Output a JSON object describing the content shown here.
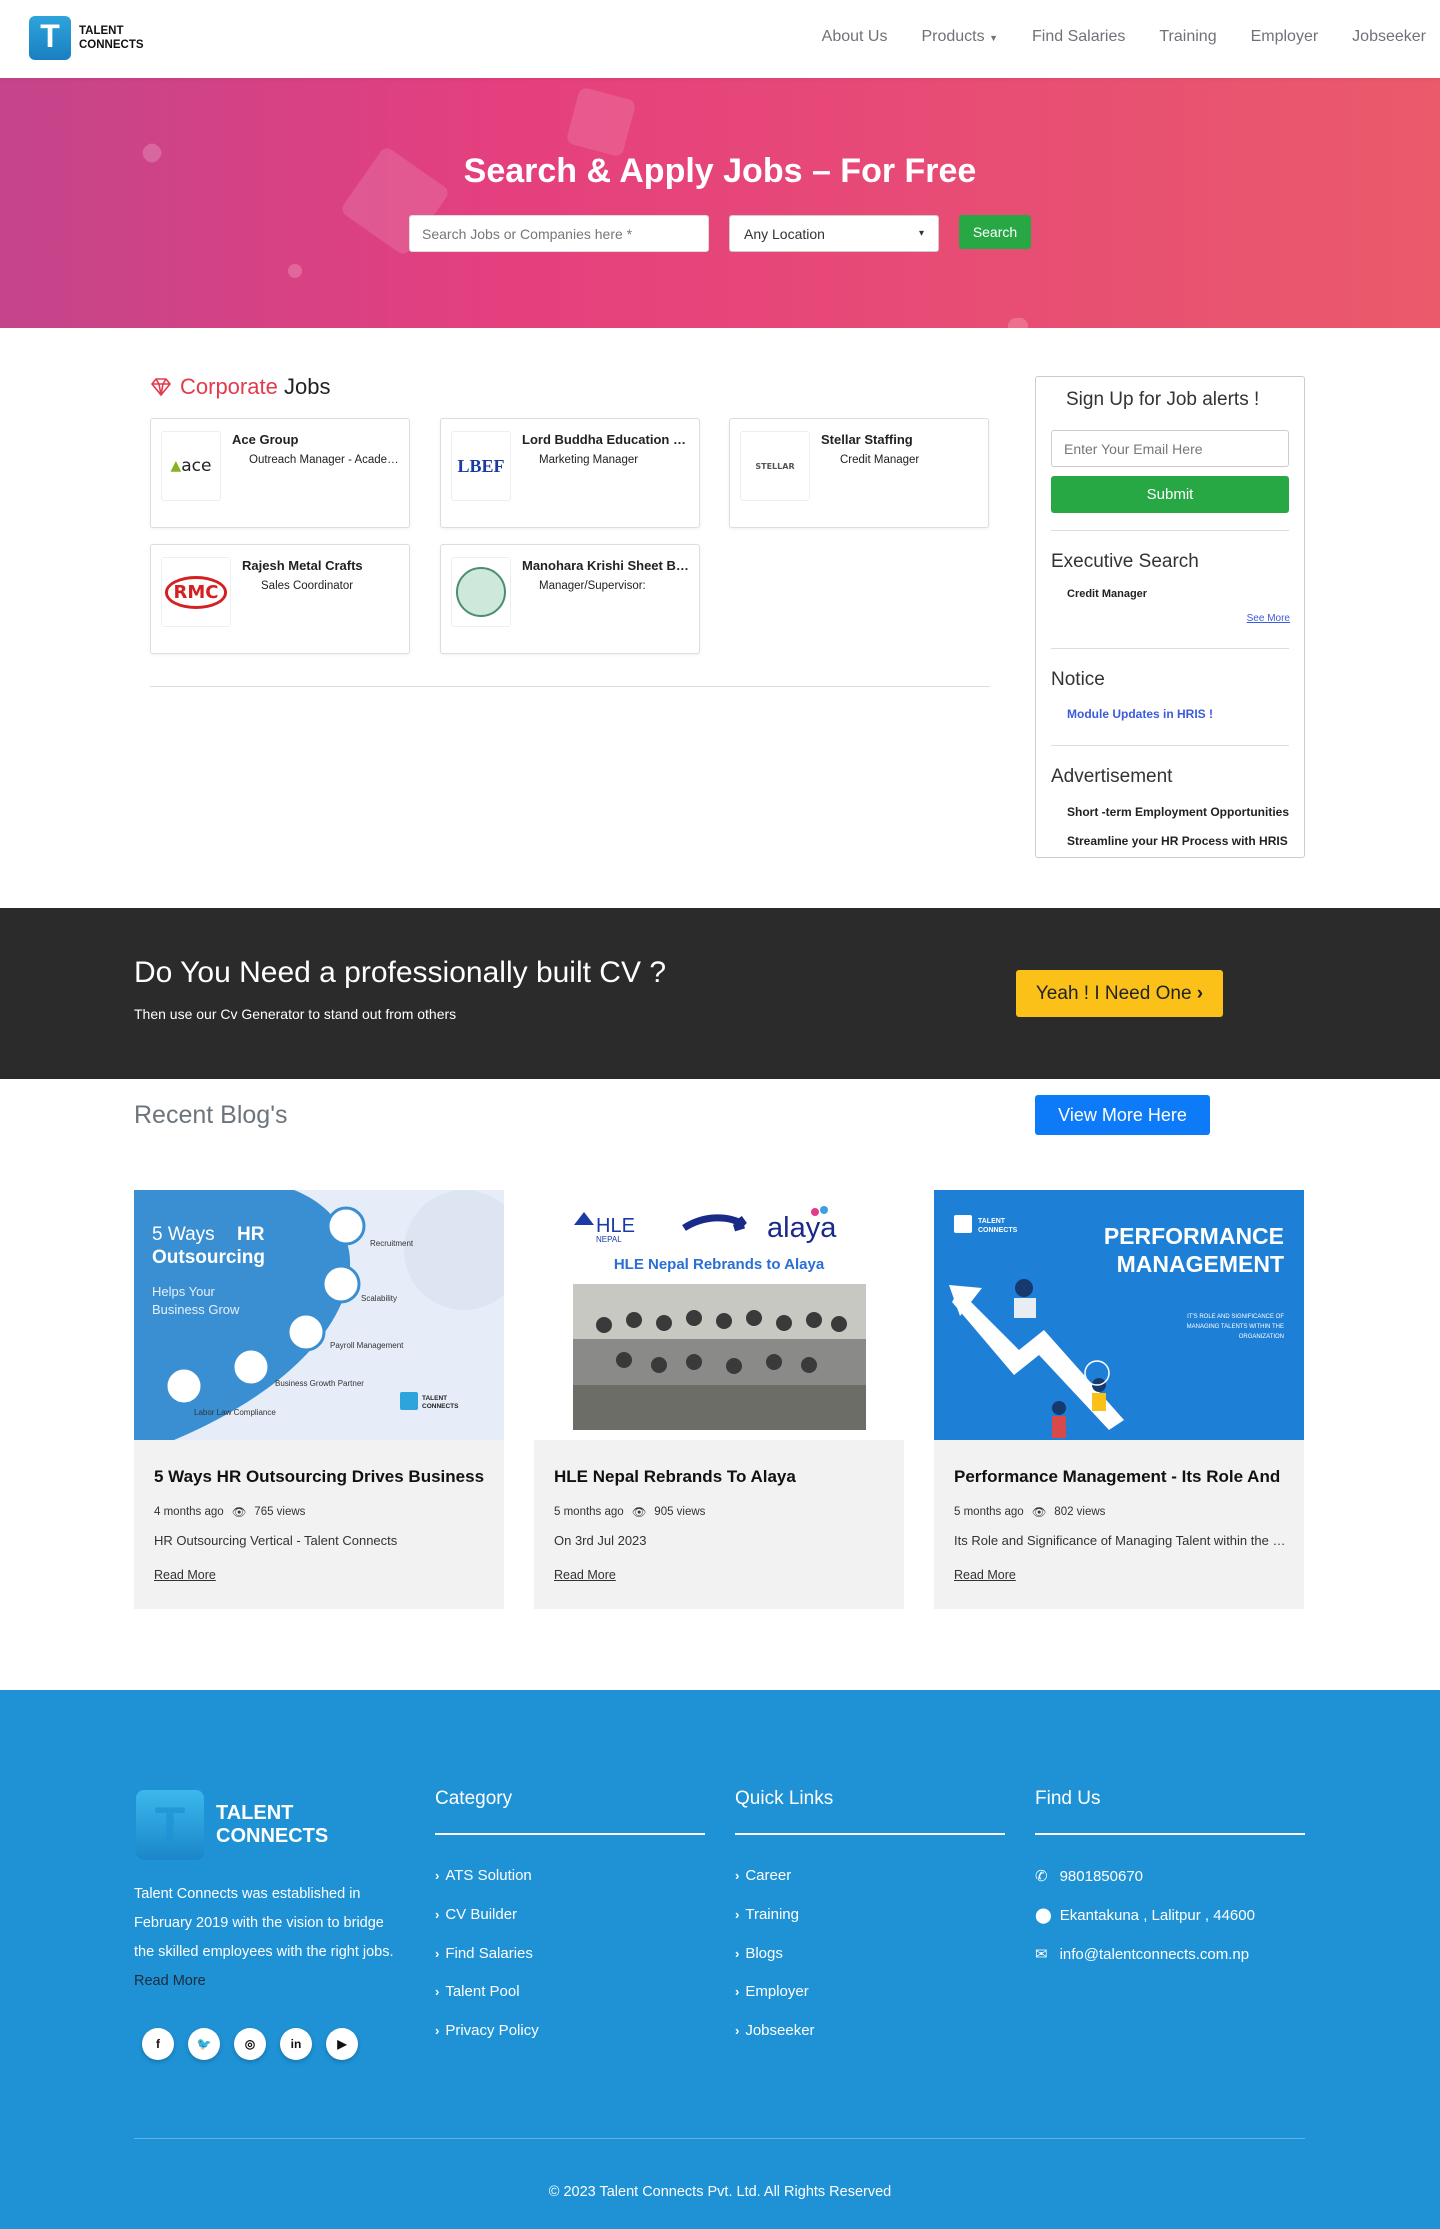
{
  "header": {
    "logo_text_line1": "TALENT",
    "logo_text_line2": "CONNECTS",
    "nav": [
      "About Us",
      "Products",
      "Find Salaries",
      "Training",
      "Employer",
      "Jobseeker"
    ]
  },
  "hero": {
    "title": "Search & Apply Jobs – For Free",
    "search_placeholder": "Search Jobs or Companies here *",
    "location_value": "Any Location",
    "search_label": "Search"
  },
  "corporate": {
    "title_accent": "Corporate",
    "title_rest": "Jobs",
    "cards": [
      {
        "company": "Ace Group",
        "position": "Outreach Manager - Academic...",
        "logo_text": "ace"
      },
      {
        "company": "Lord Buddha Education Foundation",
        "position": "Marketing Manager",
        "logo_text": "LBEF"
      },
      {
        "company": "Stellar Staffing",
        "position": "Credit Manager",
        "logo_text": "STELLAR"
      },
      {
        "company": "Rajesh Metal Crafts",
        "position": "Sales Coordinator",
        "logo_text": "RMC"
      },
      {
        "company": "Manohara Krishi Sheet Bhandar",
        "position": "Manager/Supervisor:",
        "logo_text": ""
      }
    ]
  },
  "sidebar": {
    "signup_title": "Sign Up for Job alerts !",
    "email_placeholder": "Enter Your Email Here",
    "submit_label": "Submit",
    "exec_title": "Executive Search",
    "exec_items": [
      "Credit Manager"
    ],
    "see_more": "See More",
    "notice_title": "Notice",
    "notice_items": [
      "Module Updates in HRIS !"
    ],
    "ad_title": "Advertisement",
    "ad_items": [
      "Short -term Employment Opportunities",
      "Streamline your HR Process with HRIS"
    ]
  },
  "cv": {
    "title": "Do You Need a professionally built CV ?",
    "subtitle": "Then use our Cv Generator to stand out from others",
    "button": "Yeah ! I Need One"
  },
  "blogs": {
    "title": "Recent Blog's",
    "view_more": "View More Here",
    "items": [
      {
        "title": "5 Ways HR Outsourcing Drives Business",
        "time": "4 months ago",
        "views": "765 views",
        "desc": "HR Outsourcing Vertical - Talent Connects",
        "read": "Read More"
      },
      {
        "title": "HLE Nepal Rebrands To Alaya",
        "time": "5 months ago",
        "views": "905 views",
        "desc": "On 3rd Jul 2023",
        "read": "Read More"
      },
      {
        "title": "Performance Management - Its Role And",
        "time": "5 months ago",
        "views": "802 views",
        "desc": "Its Role and Significance of Managing Talent within the Organization",
        "read": "Read More"
      }
    ],
    "img1": {
      "line1": "5 Ways",
      "line1b": "HR",
      "line2": "Outsourcing",
      "sub1": "Helps Your",
      "sub2": "Business Grow",
      "labels": [
        "Recruitment",
        "Scalability",
        "Payroll Management",
        "Business Growth Partner",
        "Labor Law Compliance"
      ],
      "brand1": "TALENT",
      "brand2": "CONNECTS"
    },
    "img2": {
      "hle": "HLE",
      "nepal": "NEPAL",
      "alaya": "alaya",
      "caption": "HLE Nepal Rebrands to Alaya"
    },
    "img3": {
      "title1": "PERFORMANCE",
      "title2": "MANAGEMENT",
      "sub1": "IT'S ROLE AND SIGNIFICANCE OF",
      "sub2": "MANAGING TALENTS WITHIN THE",
      "sub3": "ORGANIZATION",
      "brand1": "TALENT",
      "brand2": "CONNECTS"
    }
  },
  "footer": {
    "logo1": "TALENT",
    "logo2": "CONNECTS",
    "about": "Talent Connects was established in February 2019 with the vision to bridge the skilled employees with the right jobs.",
    "about_more": "Read More",
    "category_title": "Category",
    "category": [
      "ATS Solution",
      "CV Builder",
      "Find Salaries",
      "Talent Pool",
      "Privacy Policy"
    ],
    "quick_title": "Quick Links",
    "quick": [
      "Career",
      "Training",
      "Blogs",
      "Employer",
      "Jobseeker"
    ],
    "find_title": "Find Us",
    "phone": "9801850670",
    "address": "Ekantakuna , Lalitpur , 44600",
    "email": "info@talentconnects.com.np",
    "copyright": "© 2023 Talent Connects Pvt. Ltd. All Rights Reserved"
  },
  "colors": {
    "accent_red": "#e23b4c",
    "green": "#28a745",
    "blue": "#0d7bf7",
    "footer_blue": "#1e92d5",
    "yellow": "#fbc119"
  }
}
